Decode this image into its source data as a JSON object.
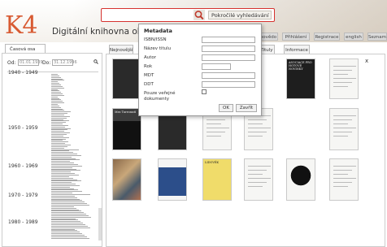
{
  "header": {
    "logo": "K4",
    "title": "Digitální knihovna obsahuj",
    "search_placeholder": "",
    "advanced_search": "Pokročilé vyhledávání",
    "nav": [
      "povědo",
      "Přihlášení",
      "Registrace",
      "english",
      "Seznam"
    ]
  },
  "left": {
    "tab": "Časová osa",
    "from_label": "Od:",
    "to_label": "Do:",
    "from_value": "01.01.1939",
    "to_value": "31.12.1996",
    "decades": [
      "1940 - 1949",
      "1950 - 1959",
      "1960 - 1969",
      "1970 - 1979",
      "1980 - 1989"
    ]
  },
  "main": {
    "tabs": [
      "Nejnovější",
      "Tituly",
      "Informace"
    ],
    "close": "x",
    "thumbnails": [
      {
        "title": "",
        "style": "dark"
      },
      {
        "title": "ASOCIACE PRO HOTOVÉ NOVINKY",
        "style": "black-title"
      },
      {
        "title": "",
        "style": "text-page"
      },
      {
        "title": "Mes Turromstí",
        "style": "dark-title"
      },
      {
        "title": "",
        "style": "black"
      },
      {
        "title": "",
        "style": "text-page"
      },
      {
        "title": "",
        "style": "text-page"
      },
      {
        "title": "",
        "style": "text-page"
      },
      {
        "title": "",
        "style": "photo"
      },
      {
        "title": "",
        "style": "blue-card"
      },
      {
        "title": "LIDOVÉK",
        "style": "yellow"
      },
      {
        "title": "",
        "style": "text-page"
      },
      {
        "title": "",
        "style": "circle"
      },
      {
        "title": "",
        "style": "text-page"
      }
    ]
  },
  "dropdown": {
    "title": "Metadata",
    "fields": [
      "ISBN/ISSN",
      "Název titulu",
      "Autor",
      "Rok",
      "MDT",
      "DDT",
      "Pouze veřejné dokumenty"
    ],
    "ok": "OK",
    "cancel": "Zavřít"
  },
  "colors": {
    "logo": "#d85a32",
    "search_border": "#d6322f"
  }
}
